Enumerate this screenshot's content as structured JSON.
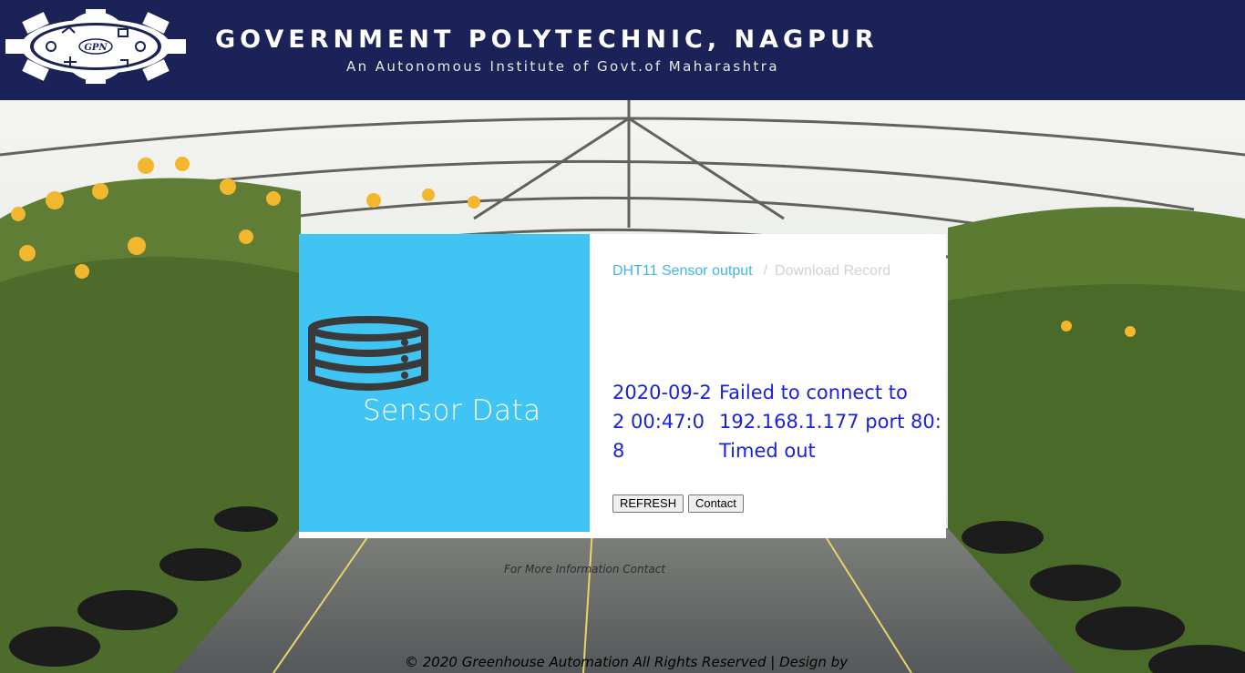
{
  "header": {
    "institute_name": "GOVERNMENT POLYTECHNIC, NAGPUR",
    "institute_subtitle": "An Autonomous Institute of Govt.of Maharashtra",
    "logo_text": "GPN"
  },
  "card": {
    "panel_title": "Sensor Data",
    "breadcrumb": {
      "active": "DHT11 Sensor output",
      "separator": "/",
      "inactive": "Download Record"
    },
    "reading": {
      "timestamp": "2020-09-22 00:47:08",
      "message": "Failed to connect to 192.168.1.177 port 80: Timed out"
    },
    "buttons": {
      "refresh": "REFRESH",
      "contact": "Contact"
    }
  },
  "more_info": "For More Information Contact",
  "footer": "© 2020 Greenhouse Automation All Rights Reserved | Design by",
  "colors": {
    "header_bg": "#1a2257",
    "panel_blue": "#40c4f4",
    "reading_text": "#1a22d6",
    "breadcrumb_active": "#40b6e8"
  }
}
